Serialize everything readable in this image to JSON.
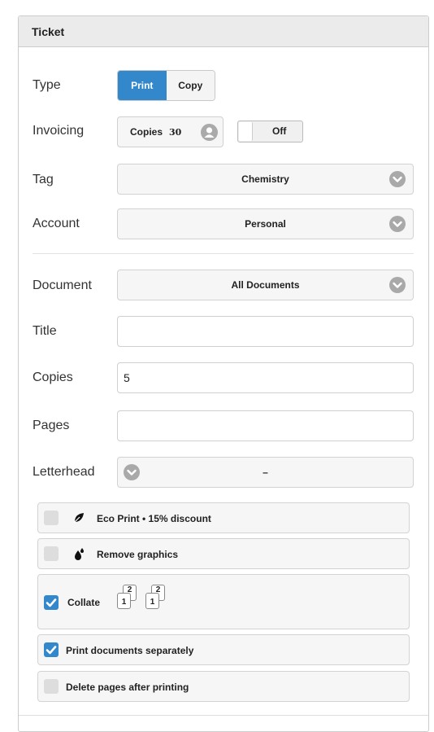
{
  "panel": {
    "title": "Ticket"
  },
  "type": {
    "label": "Type",
    "options": [
      "Print",
      "Copy"
    ],
    "selected": "Print"
  },
  "invoicing": {
    "label": "Invoicing",
    "copies_label": "Copies",
    "copies_value": "30",
    "toggle_label": "Off",
    "toggle_state": "off"
  },
  "tag": {
    "label": "Tag",
    "value": "Chemistry"
  },
  "account": {
    "label": "Account",
    "value": "Personal"
  },
  "document": {
    "label": "Document",
    "value": "All Documents"
  },
  "title": {
    "label": "Title",
    "value": ""
  },
  "copies": {
    "label": "Copies",
    "value": "5"
  },
  "pages": {
    "label": "Pages",
    "value": ""
  },
  "letterhead": {
    "label": "Letterhead",
    "value": "–"
  },
  "options": {
    "eco": {
      "label": "Eco Print • 15% discount",
      "checked": false,
      "icon": "leaf-icon"
    },
    "remove_graphics": {
      "label": "Remove graphics",
      "checked": false,
      "icon": "ink-drops-icon"
    },
    "collate": {
      "label": "Collate",
      "checked": true,
      "page_top": "2",
      "page_bottom": "1"
    },
    "separately": {
      "label": "Print documents separately",
      "checked": true
    },
    "delete_after": {
      "label": "Delete pages after printing",
      "checked": false
    }
  },
  "colors": {
    "accent": "#3388cc",
    "header_bg": "#ebebeb"
  }
}
